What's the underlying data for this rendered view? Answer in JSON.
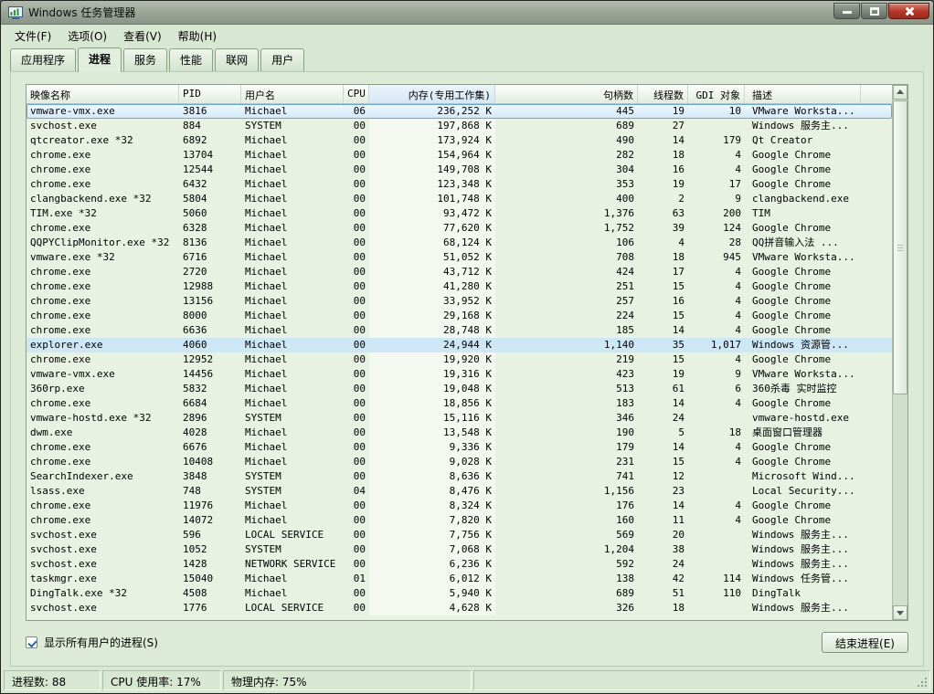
{
  "window": {
    "title": "Windows 任务管理器"
  },
  "menu": {
    "items": [
      "文件(F)",
      "选项(O)",
      "查看(V)",
      "帮助(H)"
    ]
  },
  "tabs": {
    "items": [
      "应用程序",
      "进程",
      "服务",
      "性能",
      "联网",
      "用户"
    ],
    "selected": "进程"
  },
  "table": {
    "columns": [
      "映像名称",
      "PID",
      "用户名",
      "CPU",
      "内存(专用工作集)",
      "句柄数",
      "线程数",
      "GDI 对象",
      "描述"
    ],
    "column_keys": [
      "image-name",
      "pid",
      "user-name",
      "cpu",
      "memory",
      "handles",
      "threads",
      "gdi-objects",
      "description"
    ],
    "sorted_column": 4,
    "selected_row": 0,
    "hot_row": 16,
    "rows": [
      [
        "vmware-vmx.exe",
        "3816",
        "Michael",
        "06",
        "236,252 K",
        "445",
        "19",
        "10",
        "VMware Worksta..."
      ],
      [
        "svchost.exe",
        "884",
        "SYSTEM",
        "00",
        "197,868 K",
        "689",
        "27",
        "",
        "Windows 服务主..."
      ],
      [
        "qtcreator.exe *32",
        "6892",
        "Michael",
        "00",
        "173,924 K",
        "490",
        "14",
        "179",
        "Qt Creator"
      ],
      [
        "chrome.exe",
        "13704",
        "Michael",
        "00",
        "154,964 K",
        "282",
        "18",
        "4",
        "Google Chrome"
      ],
      [
        "chrome.exe",
        "12544",
        "Michael",
        "00",
        "149,708 K",
        "304",
        "16",
        "4",
        "Google Chrome"
      ],
      [
        "chrome.exe",
        "6432",
        "Michael",
        "00",
        "123,348 K",
        "353",
        "19",
        "17",
        "Google Chrome"
      ],
      [
        "clangbackend.exe *32",
        "5804",
        "Michael",
        "00",
        "101,748 K",
        "400",
        "2",
        "9",
        "clangbackend.exe"
      ],
      [
        "TIM.exe *32",
        "5060",
        "Michael",
        "00",
        "93,472 K",
        "1,376",
        "63",
        "200",
        "TIM"
      ],
      [
        "chrome.exe",
        "6328",
        "Michael",
        "00",
        "77,620 K",
        "1,752",
        "39",
        "124",
        "Google Chrome"
      ],
      [
        "QQPYClipMonitor.exe *32",
        "8136",
        "Michael",
        "00",
        "68,124 K",
        "106",
        "4",
        "28",
        "QQ拼音输入法 ..."
      ],
      [
        "vmware.exe *32",
        "6716",
        "Michael",
        "00",
        "51,052 K",
        "708",
        "18",
        "945",
        "VMware Worksta..."
      ],
      [
        "chrome.exe",
        "2720",
        "Michael",
        "00",
        "43,712 K",
        "424",
        "17",
        "4",
        "Google Chrome"
      ],
      [
        "chrome.exe",
        "12988",
        "Michael",
        "00",
        "41,280 K",
        "251",
        "15",
        "4",
        "Google Chrome"
      ],
      [
        "chrome.exe",
        "13156",
        "Michael",
        "00",
        "33,952 K",
        "257",
        "16",
        "4",
        "Google Chrome"
      ],
      [
        "chrome.exe",
        "8000",
        "Michael",
        "00",
        "29,168 K",
        "224",
        "15",
        "4",
        "Google Chrome"
      ],
      [
        "chrome.exe",
        "6636",
        "Michael",
        "00",
        "28,748 K",
        "185",
        "14",
        "4",
        "Google Chrome"
      ],
      [
        "explorer.exe",
        "4060",
        "Michael",
        "00",
        "24,944 K",
        "1,140",
        "35",
        "1,017",
        "Windows 资源管..."
      ],
      [
        "chrome.exe",
        "12952",
        "Michael",
        "00",
        "19,920 K",
        "219",
        "15",
        "4",
        "Google Chrome"
      ],
      [
        "vmware-vmx.exe",
        "14456",
        "Michael",
        "00",
        "19,316 K",
        "423",
        "19",
        "9",
        "VMware Worksta..."
      ],
      [
        "360rp.exe",
        "5832",
        "Michael",
        "00",
        "19,048 K",
        "513",
        "61",
        "6",
        "360杀毒 实时监控"
      ],
      [
        "chrome.exe",
        "6684",
        "Michael",
        "00",
        "18,856 K",
        "183",
        "14",
        "4",
        "Google Chrome"
      ],
      [
        "vmware-hostd.exe *32",
        "2896",
        "SYSTEM",
        "00",
        "15,116 K",
        "346",
        "24",
        "",
        "vmware-hostd.exe"
      ],
      [
        "dwm.exe",
        "4028",
        "Michael",
        "00",
        "13,548 K",
        "190",
        "5",
        "18",
        "桌面窗口管理器"
      ],
      [
        "chrome.exe",
        "6676",
        "Michael",
        "00",
        "9,336 K",
        "179",
        "14",
        "4",
        "Google Chrome"
      ],
      [
        "chrome.exe",
        "10408",
        "Michael",
        "00",
        "9,028 K",
        "231",
        "15",
        "4",
        "Google Chrome"
      ],
      [
        "SearchIndexer.exe",
        "3848",
        "SYSTEM",
        "00",
        "8,636 K",
        "741",
        "12",
        "",
        "Microsoft Wind..."
      ],
      [
        "lsass.exe",
        "748",
        "SYSTEM",
        "04",
        "8,476 K",
        "1,156",
        "23",
        "",
        "Local Security..."
      ],
      [
        "chrome.exe",
        "11976",
        "Michael",
        "00",
        "8,324 K",
        "176",
        "14",
        "4",
        "Google Chrome"
      ],
      [
        "chrome.exe",
        "14072",
        "Michael",
        "00",
        "7,820 K",
        "160",
        "11",
        "4",
        "Google Chrome"
      ],
      [
        "svchost.exe",
        "596",
        "LOCAL SERVICE",
        "00",
        "7,756 K",
        "569",
        "20",
        "",
        "Windows 服务主..."
      ],
      [
        "svchost.exe",
        "1052",
        "SYSTEM",
        "00",
        "7,068 K",
        "1,204",
        "38",
        "",
        "Windows 服务主..."
      ],
      [
        "svchost.exe",
        "1428",
        "NETWORK SERVICE",
        "00",
        "6,236 K",
        "592",
        "24",
        "",
        "Windows 服务主..."
      ],
      [
        "taskmgr.exe",
        "15040",
        "Michael",
        "01",
        "6,012 K",
        "138",
        "42",
        "114",
        "Windows 任务管..."
      ],
      [
        "DingTalk.exe *32",
        "4508",
        "Michael",
        "00",
        "5,940 K",
        "689",
        "51",
        "110",
        "DingTalk"
      ],
      [
        "svchost.exe",
        "1776",
        "LOCAL SERVICE",
        "00",
        "4,628 K",
        "326",
        "18",
        "",
        "Windows 服务主..."
      ]
    ]
  },
  "footer": {
    "show_all_processes": "显示所有用户的进程(S)",
    "checkbox_checked": true,
    "end_process": "结束进程(E)"
  },
  "statusbar": {
    "process_count": "进程数: 88",
    "cpu_usage": "CPU 使用率: 17%",
    "physical_memory": "物理内存: 75%"
  }
}
